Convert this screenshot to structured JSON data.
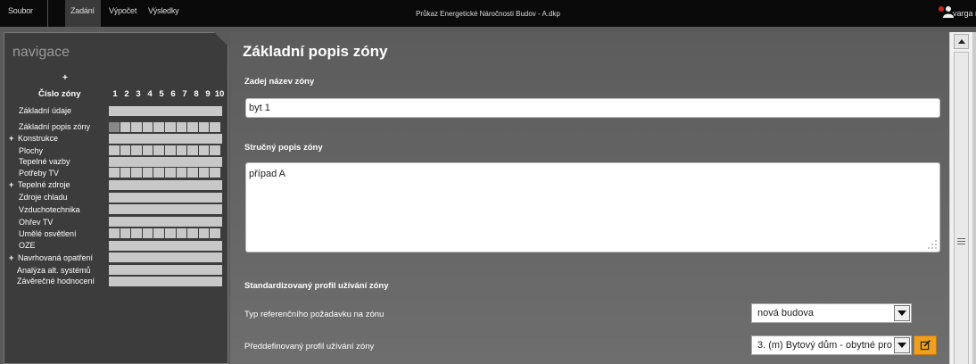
{
  "topbar": {
    "menu": [
      "Soubor",
      "Zadání",
      "Výpočet",
      "Výsledky"
    ],
    "active_tab": "Zadání",
    "window_title": "Průkaz Energetické Náročnosti Budov - A.dkp",
    "user": "varga m"
  },
  "sidebar": {
    "title": "navigace",
    "plus": "+",
    "zone_label": "Číslo zóny",
    "zone_numbers": [
      "1",
      "2",
      "3",
      "4",
      "5",
      "6",
      "7",
      "8",
      "9",
      "10"
    ],
    "items": [
      {
        "label": "Základní údaje",
        "plus": ""
      },
      {
        "label": "Základní popis zóny",
        "plus": ""
      },
      {
        "label": "Konstrukce",
        "plus": "+"
      },
      {
        "label": "Plochy",
        "plus": ""
      },
      {
        "label": "Tepelné vazby",
        "plus": ""
      },
      {
        "label": "Potřeby TV",
        "plus": ""
      },
      {
        "label": "Tepelné zdroje",
        "plus": "+"
      },
      {
        "label": "Zdroje chladu",
        "plus": ""
      },
      {
        "label": "Vzduchotechnika",
        "plus": ""
      },
      {
        "label": "Ohřev TV",
        "plus": ""
      },
      {
        "label": "Umělé osvětlení",
        "plus": ""
      },
      {
        "label": "OZE",
        "plus": ""
      },
      {
        "label": "Navrhovaná opatření",
        "plus": "+"
      },
      {
        "label": "Analýza alt. systémů",
        "plus": ""
      },
      {
        "label": "Závěrečné hodnocení",
        "plus": ""
      }
    ]
  },
  "main": {
    "heading": "Základní popis zóny",
    "zone_name_label": "Zadej název zóny",
    "zone_name_value": "byt 1",
    "short_desc_label": "Stručný popis zóny",
    "short_desc_value": "případ A",
    "profile_section_label": "Standardizovaný profil užívání zóny",
    "ref_req_label": "Typ referenčního požadavku na zónu",
    "ref_req_value": "nová budova",
    "predef_profile_label": "Předdefinovaný profil užívání zóny",
    "predef_profile_value": "3. (m) Bytový dům - obytné pro"
  },
  "icons": {
    "user": "user-icon",
    "notification": "notification-icon",
    "edit": "edit-icon",
    "resize": "resize-grip-icon",
    "scroll_up": "scroll-up-icon"
  },
  "colors": {
    "accent": "#f0a020",
    "notify": "#d02020"
  }
}
